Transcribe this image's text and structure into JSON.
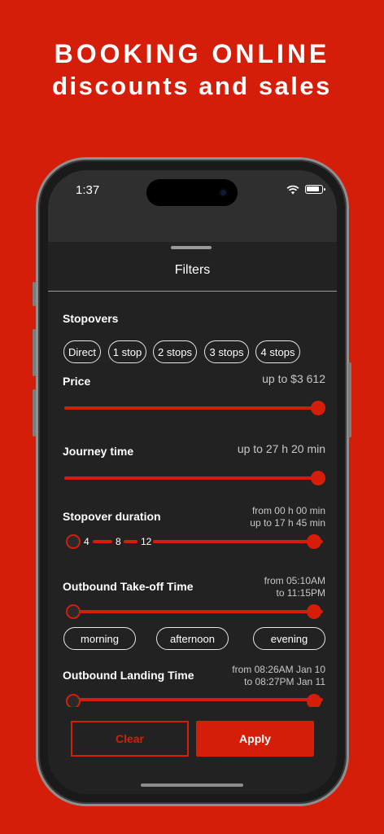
{
  "banner": {
    "line1": "BOOKING ONLINE",
    "line2": "discounts and sales"
  },
  "status_bar": {
    "time": "1:37",
    "icons": [
      "wifi-icon",
      "battery-icon"
    ]
  },
  "sheet": {
    "title": "Filters"
  },
  "stopovers": {
    "label": "Stopovers",
    "options": [
      "Direct",
      "1 stop",
      "2 stops",
      "3 stops",
      "4 stops"
    ]
  },
  "price": {
    "label": "Price",
    "value": "up to $3 612",
    "level": 1.0
  },
  "journey_time": {
    "label": "Journey time",
    "value": "up to 27 h 20 min",
    "level": 1.0
  },
  "stopover_duration": {
    "label": "Stopover duration",
    "from": "from 00 h 00 min",
    "to": "up to 17 h 45 min",
    "ticks": [
      "4",
      "8",
      "12"
    ]
  },
  "outbound_takeoff": {
    "label": "Outbound Take-off Time",
    "from": "from 05:10AM",
    "to": "to 11:15PM",
    "periods": [
      "morning",
      "afternoon",
      "evening"
    ]
  },
  "outbound_landing": {
    "label": "Outbound Landing Time",
    "from": "from 08:26AM Jan 10",
    "to": "to 08:27PM Jan 11"
  },
  "actions": {
    "clear": "Clear",
    "apply": "Apply"
  },
  "colors": {
    "accent": "#d41e0a",
    "sheet_bg": "#222222",
    "text": "#ffffff",
    "muted": "#c8c8c8"
  }
}
